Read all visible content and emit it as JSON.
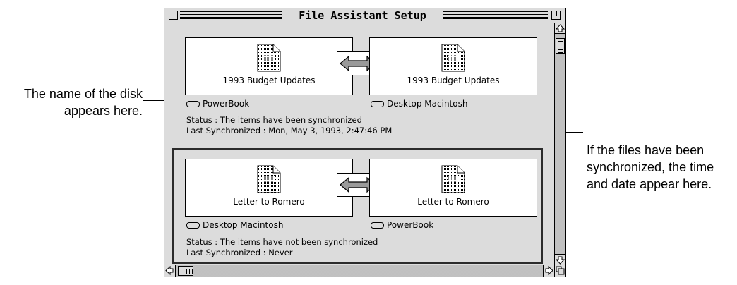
{
  "window": {
    "title": "File Assistant Setup"
  },
  "pairs": [
    {
      "left_file": "1993 Budget Updates",
      "right_file": "1993 Budget Updates",
      "left_disk": "PowerBook",
      "right_disk": "Desktop Macintosh",
      "status": "Status : The items have been synchronized",
      "last_sync": "Last Synchronized : Mon, May 3, 1993, 2:47:46 PM",
      "selected": false
    },
    {
      "left_file": "Letter to Romero",
      "right_file": "Letter to Romero",
      "left_disk": "Desktop Macintosh",
      "right_disk": "PowerBook",
      "status": "Status : The items have not been synchronized",
      "last_sync": "Last Synchronized : Never",
      "selected": true
    }
  ],
  "callouts": {
    "left_line1": "The name of the disk",
    "left_line2": "appears here.",
    "right_line1": "If the files have been",
    "right_line2": "synchronized, the time",
    "right_line3": "and date appear here."
  },
  "icons": {
    "document": "document-icon",
    "swap": "double-arrow-icon",
    "disk": "disk-icon"
  }
}
